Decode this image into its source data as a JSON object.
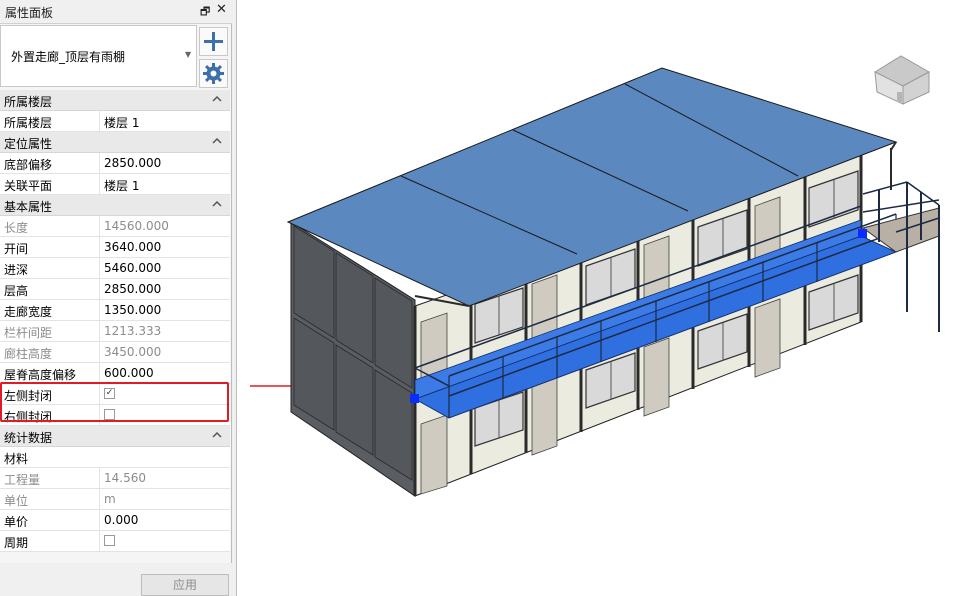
{
  "panel": {
    "title": "属性面板",
    "type_name": "外置走廊_顶层有雨棚",
    "apply_label": "应用"
  },
  "categories": {
    "level": "所属楼层",
    "locate": "定位属性",
    "basic": "基本属性",
    "stats": "统计数据"
  },
  "props": {
    "level": {
      "label": "所属楼层",
      "value": "楼层 1"
    },
    "base_offset": {
      "label": "底部偏移",
      "value": "2850.000"
    },
    "ref_plane": {
      "label": "关联平面",
      "value": "楼层 1"
    },
    "length": {
      "label": "长度",
      "value": "14560.000"
    },
    "bay": {
      "label": "开间",
      "value": "3640.000"
    },
    "depth": {
      "label": "进深",
      "value": "5460.000"
    },
    "floor_height": {
      "label": "层高",
      "value": "2850.000"
    },
    "corridor_width": {
      "label": "走廊宽度",
      "value": "1350.000"
    },
    "rail_spacing": {
      "label": "栏杆间距",
      "value": "1213.333"
    },
    "column_height": {
      "label": "廊柱高度",
      "value": "3450.000"
    },
    "ridge_offset": {
      "label": "屋脊高度偏移",
      "value": "600.000"
    },
    "left_closed": {
      "label": "左侧封闭",
      "checked": true
    },
    "right_closed": {
      "label": "右侧封闭",
      "checked": false
    },
    "material": {
      "label": "材料",
      "value": ""
    },
    "quantity": {
      "label": "工程量",
      "value": "14.560"
    },
    "unit": {
      "label": "单位",
      "value": "m"
    },
    "unit_price": {
      "label": "单价",
      "value": "0.000"
    },
    "period": {
      "label": "周期",
      "checked": false
    }
  },
  "icons": {
    "pin": "restore-icon",
    "close": "close-icon",
    "add": "plus-icon",
    "settings": "gear-icon",
    "viewcube": "house-viewcube-icon"
  },
  "colors": {
    "roof": "#5b88bf",
    "corridor": "#2f6fe0",
    "wall": "#ecebe0",
    "side_wall": "#5a5d62",
    "highlight": "#e01b24",
    "grip": "#0a2cff"
  },
  "checkmark": "✓"
}
